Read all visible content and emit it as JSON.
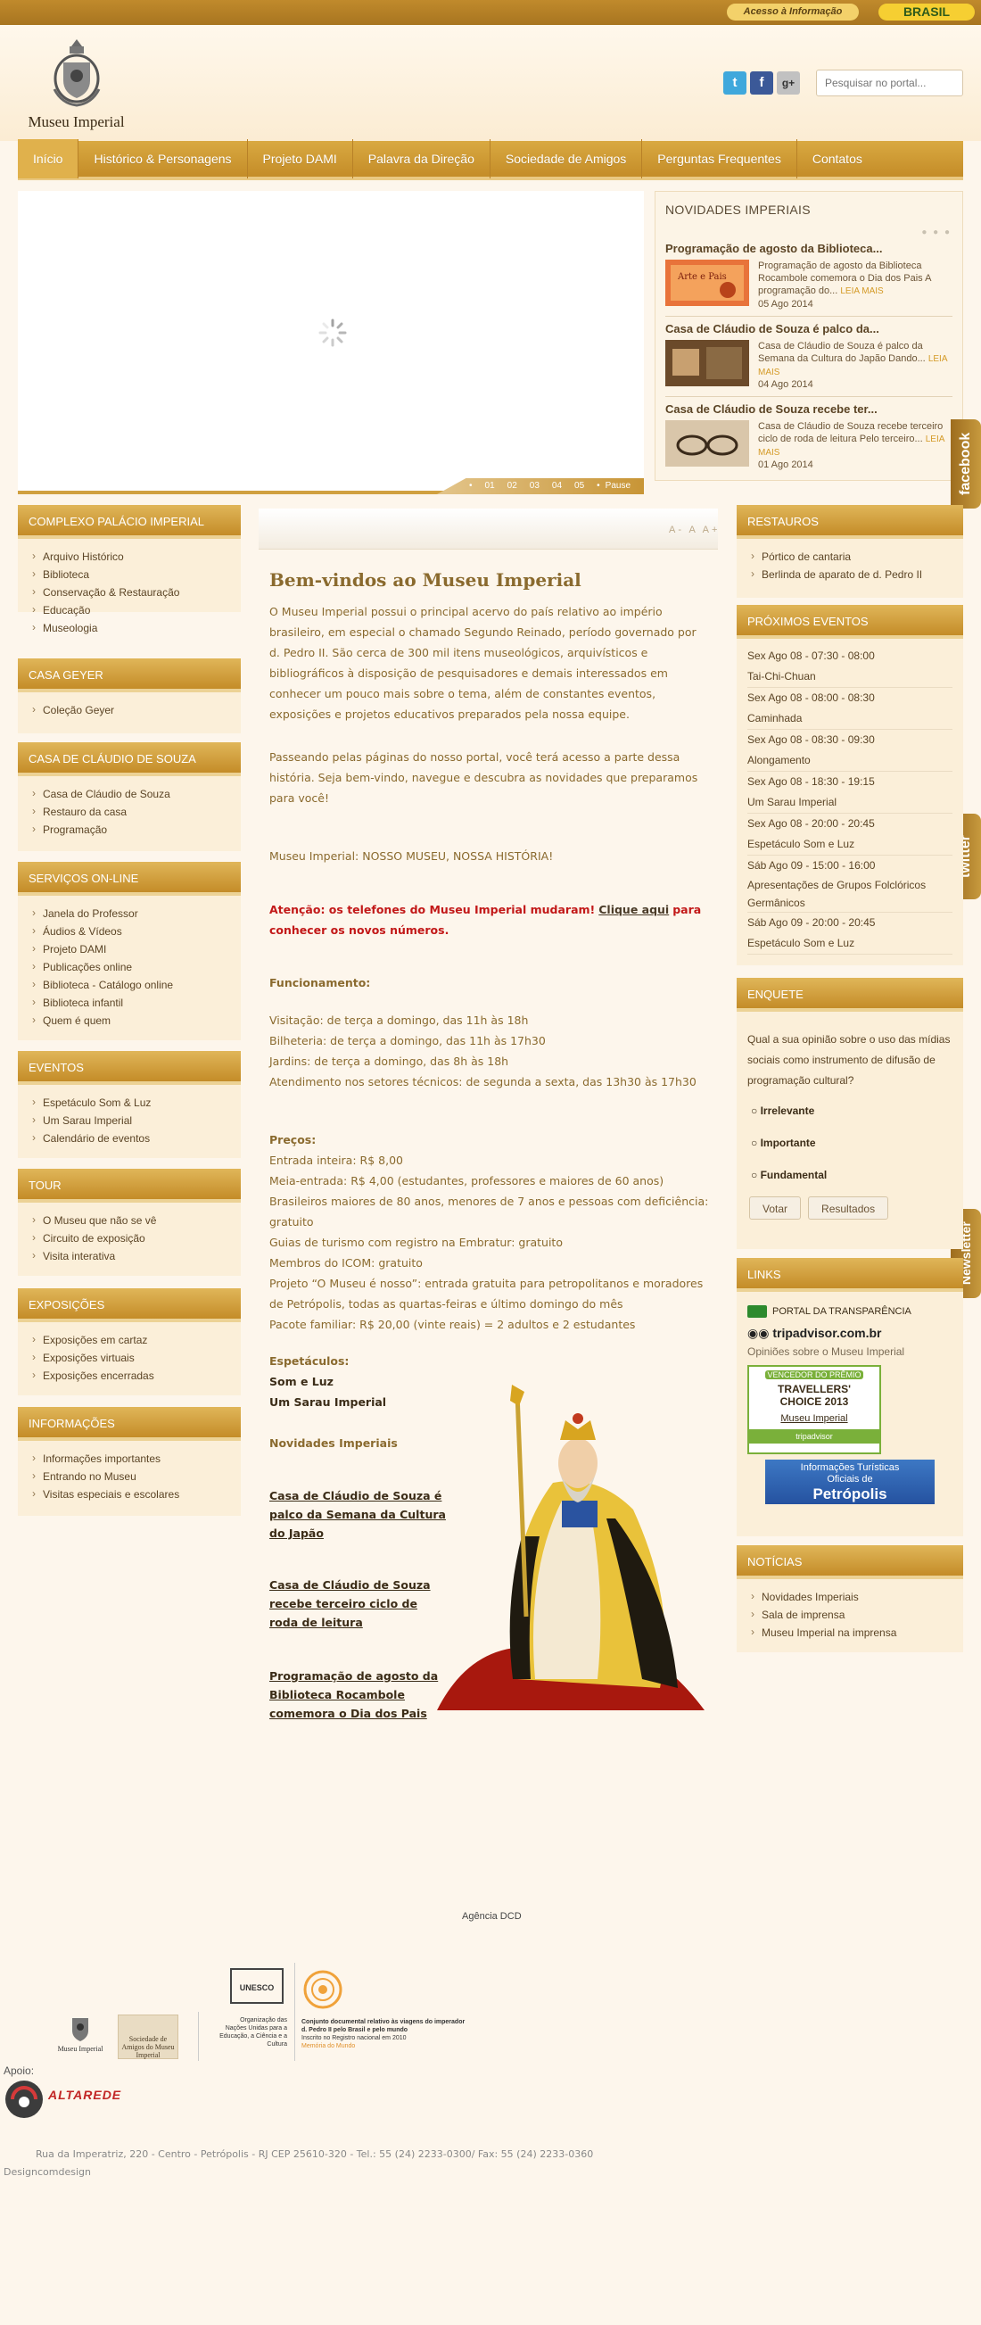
{
  "topbar": {
    "acesso": "Acesso à Informação",
    "brasil": "BRASIL"
  },
  "header": {
    "logo_text": "Museu Imperial",
    "search_placeholder": "Pesquisar no portal..."
  },
  "nav": {
    "items": [
      "Início",
      "Histórico & Personagens",
      "Projeto DAMI",
      "Palavra da Direção",
      "Sociedade de Amigos",
      "Perguntas Frequentes",
      "Contatos"
    ]
  },
  "slider": {
    "nav": [
      "01",
      "02",
      "03",
      "04",
      "05"
    ],
    "pause": "Pause"
  },
  "novidades": {
    "title": "NOVIDADES IMPERIAIS",
    "items": [
      {
        "title": "Programação de agosto da Biblioteca...",
        "desc": "Programação de agosto da Biblioteca Rocambole comemora o Dia dos Pais   A programação do...",
        "leia": "LEIA MAIS",
        "date": "05 Ago 2014"
      },
      {
        "title": "Casa de Cláudio de Souza é palco da...",
        "desc": "Casa de Cláudio de Souza é palco da Semana da Cultura do Japão   Dando...",
        "leia": "LEIA MAIS",
        "date": "04 Ago 2014"
      },
      {
        "title": "Casa de Cláudio de Souza recebe ter...",
        "desc": "Casa de Cláudio de Souza recebe terceiro ciclo de roda de leitura   Pelo terceiro...",
        "leia": "LEIA MAIS",
        "date": "01 Ago 2014"
      }
    ]
  },
  "sidetabs": {
    "facebook": "facebook",
    "twitter": "twitter",
    "newsletter": "Newsletter"
  },
  "left": {
    "complexo": {
      "title": "COMPLEXO PALÁCIO IMPERIAL",
      "items": [
        "Arquivo Histórico",
        "Biblioteca",
        "Conservação & Restauração",
        "Educação",
        "Museologia"
      ]
    },
    "geyer": {
      "title": "CASA GEYER",
      "items": [
        "Coleção Geyer"
      ]
    },
    "claudio": {
      "title": "CASA DE CLÁUDIO DE SOUZA",
      "items": [
        "Casa de Cláudio de Souza",
        "Restauro da casa",
        "Programação"
      ]
    },
    "servicos": {
      "title": "SERVIÇOS ON-LINE",
      "items": [
        "Janela do Professor",
        "Áudios & Vídeos",
        "Projeto DAMI",
        "Publicações online",
        "Biblioteca - Catálogo online",
        "Biblioteca infantil",
        "Quem é quem"
      ]
    },
    "eventos": {
      "title": "EVENTOS",
      "items": [
        "Espetáculo Som & Luz",
        "Um Sarau Imperial",
        "Calendário de eventos"
      ]
    },
    "tour": {
      "title": "TOUR",
      "items": [
        "O Museu que não se vê",
        "Circuito de exposição",
        "Visita interativa"
      ]
    },
    "exposicoes": {
      "title": "EXPOSIÇÕES",
      "items": [
        "Exposições em cartaz",
        "Exposições virtuais",
        "Exposições encerradas"
      ]
    },
    "informacoes": {
      "title": "INFORMAÇÕES",
      "items": [
        "Informações importantes",
        "Entrando no Museu",
        "Visitas especiais e escolares"
      ]
    }
  },
  "main": {
    "fontsize": "A- A A+",
    "welcome": "Bem-vindos ao Museu Imperial",
    "intro": "O Museu Imperial possui o principal acervo do país relativo ao império brasileiro, em especial o chamado Segundo Reinado, período governado por d. Pedro II. São cerca de 300 mil itens museológicos, arquivísticos e bibliográficos à disposição de pesquisadores e demais interessados em conhecer um pouco mais sobre o tema, além de constantes eventos, exposições e projetos educativos preparados pela nossa equipe.",
    "passeando": "Passeando pelas páginas do nosso portal, você terá acesso a parte dessa história. Seja bem-vindo, navegue e descubra as novidades que preparamos para você!",
    "slogan": "Museu Imperial: NOSSO MUSEU, NOSSA HISTÓRIA!",
    "atencao_a": "Atenção: os telefones do Museu Imperial mudaram!",
    "atencao_link": "Clique aqui",
    "atencao_b": "para conhecer os novos números.",
    "func_title": "Funcionamento:",
    "func": [
      "Visitação: de terça a domingo, das 11h às 18h",
      "Bilheteria: de terça a domingo, das 11h às 17h30",
      "Jardins: de terça a domingo, das 8h às 18h",
      "Atendimento nos setores técnicos: de segunda a sexta, das 13h30 às 17h30"
    ],
    "precos_title": "Preços:",
    "precos": [
      "Entrada inteira: R$ 8,00",
      "Meia-entrada: R$ 4,00 (estudantes, professores e maiores de 60 anos)",
      "Brasileiros maiores de 80 anos, menores de 7 anos e pessoas com deficiência: gratuito",
      "Guias de turismo com registro na Embratur: gratuito",
      "Membros do ICOM: gratuito",
      "Projeto “O Museu é nosso”: entrada gratuita para petropolitanos e moradores de Petrópolis, todas as quartas-feiras e último domingo do mês",
      "Pacote familiar: R$ 20,00 (vinte reais) = 2 adultos e 2 estudantes"
    ],
    "espet_title": "Espetáculos:",
    "espet": [
      "Som e Luz",
      "Um Sarau Imperial"
    ],
    "nov_title": "Novidades Imperiais",
    "nov_links": [
      "Casa de Cláudio de Souza é palco da Semana da Cultura do Japão",
      "Casa de Cláudio de Souza recebe terceiro ciclo de roda de leitura",
      "Programação de agosto da Biblioteca Rocambole comemora o Dia dos Pais"
    ]
  },
  "right": {
    "restauros": {
      "title": "RESTAUROS",
      "items": [
        "Pórtico de cantaria",
        "Berlinda de aparato de d. Pedro II"
      ]
    },
    "eventos": {
      "title": "PRÓXIMOS EVENTOS",
      "items": [
        {
          "when": "Sex Ago 08 - 07:30 - 08:00",
          "what": "Tai-Chi-Chuan"
        },
        {
          "when": "Sex Ago 08 - 08:00 - 08:30",
          "what": "Caminhada"
        },
        {
          "when": "Sex Ago 08 - 08:30 - 09:30",
          "what": "Alongamento"
        },
        {
          "when": "Sex Ago 08 - 18:30 - 19:15",
          "what": "Um Sarau Imperial"
        },
        {
          "when": "Sex Ago 08 - 20:00 - 20:45",
          "what": "Espetáculo Som e Luz"
        },
        {
          "when": "Sáb Ago 09 - 15:00 - 16:00",
          "what": "Apresentações de Grupos Folclóricos Germânicos"
        },
        {
          "when": "Sáb Ago 09 - 20:00 - 20:45",
          "what": "Espetáculo Som e Luz"
        }
      ]
    },
    "enquete": {
      "title": "ENQUETE",
      "question": "Qual a sua opinião sobre o uso das mídias sociais como instrumento de difusão de programação cultural?",
      "options": [
        "Irrelevante",
        "Importante",
        "Fundamental"
      ],
      "votar": "Votar",
      "resultados": "Resultados"
    },
    "links": {
      "title": "LINKS",
      "transparencia": "PORTAL DA TRANSPARÊNCIA",
      "trip": "tripadvisor.com.br",
      "opinioes": "Opiniões sobre o Museu Imperial",
      "award_top": "VENCEDOR DO PRÊMIO",
      "award_main": "TRAVELLERS' CHOICE 2013",
      "award_museu": "Museu Imperial",
      "award_trip": "tripadvisor",
      "info_a": "Informações Turísticas",
      "info_b": "Oficiais de",
      "info_c": "Petrópolis"
    },
    "noticias": {
      "title": "NOTÍCIAS",
      "items": [
        "Novidades Imperiais",
        "Sala de imprensa",
        "Museu Imperial na imprensa"
      ]
    }
  },
  "footer": {
    "agencia": "Agência DCD",
    "logo_mi": "Museu Imperial",
    "sociedade": "Sociedade de Amigos do Museu Imperial",
    "unesco": "UNESCO",
    "unesco_text": "Organização das Nações Unidas para a Educação, a Ciência e a Cultura",
    "memoria_text": "Conjunto documental relativo às viagens do imperador d. Pedro II pelo Brasil e pelo mundo",
    "memoria_sub": "Inscrito no Registro nacional em 2010",
    "memoria_link": "Memória do Mundo",
    "apoio": "Apoio:",
    "altarede": "ALTAREDE",
    "address": "Rua da Imperatriz, 220 - Centro - Petrópolis - RJ CEP 25610-320 - Tel.: 55 (24) 2233-0300/ Fax: 55 (24) 2233-0360",
    "design": "Designcomdesign"
  }
}
